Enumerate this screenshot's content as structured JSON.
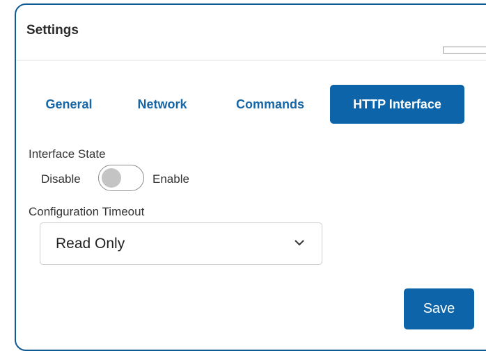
{
  "header": {
    "title": "Settings"
  },
  "tabs": [
    {
      "label": "General",
      "active": false
    },
    {
      "label": "Network",
      "active": false
    },
    {
      "label": "Commands",
      "active": false
    },
    {
      "label": "HTTP Interface",
      "active": true
    }
  ],
  "interface_state": {
    "label": "Interface State",
    "off_label": "Disable",
    "on_label": "Enable",
    "enabled": false
  },
  "configuration_timeout": {
    "label": "Configuration Timeout",
    "selected": "Read Only"
  },
  "actions": {
    "save_label": "Save"
  },
  "colors": {
    "accent": "#0e64a8",
    "border": "#0e5a93",
    "tab_text": "#1666a6"
  }
}
